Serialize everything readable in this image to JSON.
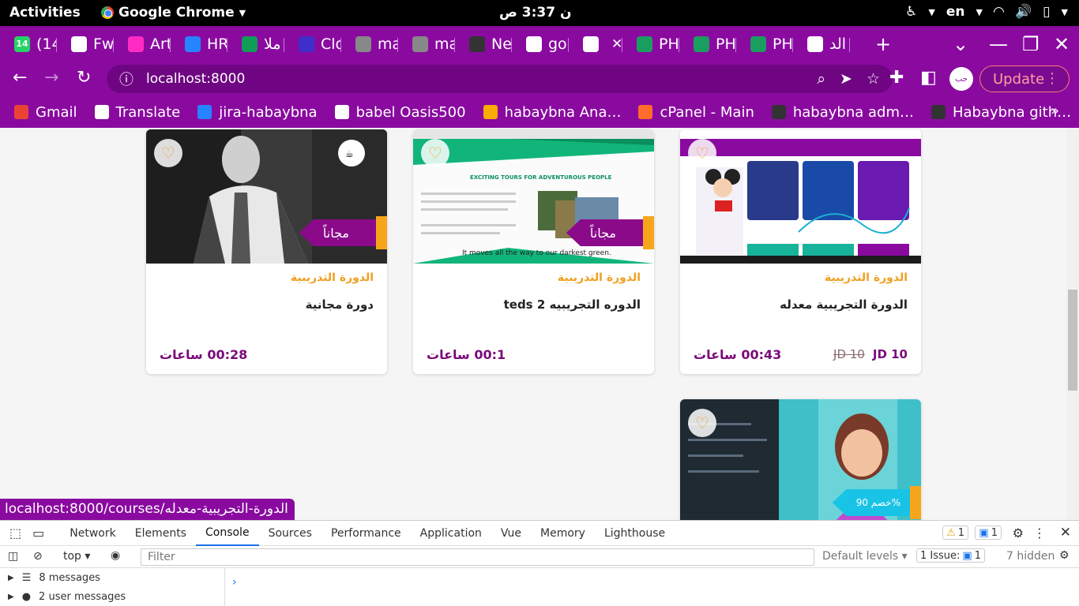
{
  "system": {
    "activities": "Activities",
    "app_name": "Google Chrome",
    "clock": "ن 3:37 ص",
    "language": "en"
  },
  "tabs": [
    {
      "label": "(14",
      "icon": "whatsapp-icon",
      "color": "#25d366",
      "badge": "14"
    },
    {
      "label": "Fw",
      "icon": "gmail-icon",
      "color": "#ffffff"
    },
    {
      "label": "Art",
      "icon": "xd-icon",
      "color": "#ff2bc2"
    },
    {
      "label": "HR",
      "icon": "jira-icon",
      "color": "#2684ff"
    },
    {
      "label": "ملا",
      "icon": "sheets-icon",
      "color": "#0f9d58"
    },
    {
      "label": "Clo",
      "icon": "cloud-icon",
      "color": "#3f2ec9"
    },
    {
      "label": "ma",
      "icon": "spiral-icon",
      "color": "#888888"
    },
    {
      "label": "ma",
      "icon": "spiral-icon",
      "color": "#888888"
    },
    {
      "label": "Ne",
      "icon": "github-icon",
      "color": "#333333"
    },
    {
      "label": "go",
      "icon": "google-icon",
      "color": "#ffffff"
    },
    {
      "label": "",
      "icon": "habaybna-icon",
      "color": "#ffffff",
      "active": true
    },
    {
      "label": "PH",
      "icon": "w-icon",
      "color": "#1a9e5f"
    },
    {
      "label": "PH",
      "icon": "w-icon",
      "color": "#1a9e5f"
    },
    {
      "label": "PH",
      "icon": "w-icon",
      "color": "#1a9e5f"
    },
    {
      "label": "الد",
      "icon": "habaybna-icon",
      "color": "#ffffff"
    }
  ],
  "nav": {
    "url": "localhost:8000",
    "update_label": "Update"
  },
  "bookmarks": [
    {
      "label": "Gmail",
      "icon": "gmail-icon",
      "color": "#ea4335"
    },
    {
      "label": "Translate",
      "icon": "globe-icon",
      "color": "#ffffff"
    },
    {
      "label": "jira-habaybna",
      "icon": "jira-icon",
      "color": "#2684ff"
    },
    {
      "label": "babel Oasis500",
      "icon": "babel-icon",
      "color": "#ffffff"
    },
    {
      "label": "habaybna Ana…",
      "icon": "analytics-icon",
      "color": "#f9ab00"
    },
    {
      "label": "cPanel - Main",
      "icon": "cpanel-icon",
      "color": "#ff6c2c"
    },
    {
      "label": "habaybna adm…",
      "icon": "m-icon",
      "color": "#333333"
    },
    {
      "label": "Habaybna gith…",
      "icon": "github-icon",
      "color": "#333333"
    }
  ],
  "courses": [
    {
      "category": "الدورة التدريبية",
      "title": "دورة مجانية",
      "duration": "00:28 ساعات",
      "ribbon": "مجاناً",
      "price": "",
      "old_price": ""
    },
    {
      "category": "الدورة التدريبية",
      "title": "الدوره التجريبيه 2 teds",
      "duration": "00:1 ساعات",
      "ribbon": "مجاناً",
      "price": "",
      "old_price": ""
    },
    {
      "category": "الدورة التدريبية",
      "title": "الدورة التجريبية معدله",
      "duration": "00:43 ساعات",
      "ribbon": "",
      "price": "JD 10",
      "old_price": "JD 10"
    },
    {
      "category": "",
      "title": "",
      "duration": "",
      "ribbon": "خصم 90%",
      "price": "",
      "old_price": ""
    }
  ],
  "thumb_text": {
    "tour_heading": "EXCITING TOURS FOR ADVENTUROUS PEOPLE",
    "tour_caption": "It moves all the way to our darkest green."
  },
  "status_url": "localhost:8000/courses/الدورة-التجريبية-معدله",
  "devtools": {
    "tabs": [
      "Network",
      "Elements",
      "Console",
      "Sources",
      "Performance",
      "Application",
      "Vue",
      "Memory",
      "Lighthouse"
    ],
    "active_tab": "Console",
    "warnings": "1",
    "infos": "1",
    "context": "top",
    "filter_placeholder": "Filter",
    "levels": "Default levels",
    "issues_label": "1 Issue:",
    "issues_count": "1",
    "hidden": "7 hidden",
    "side_items": [
      "8 messages",
      "2 user messages"
    ]
  },
  "colors": {
    "brand": "#8a0aa0",
    "accent": "#f7a61c",
    "price": "#7a0a7a"
  }
}
